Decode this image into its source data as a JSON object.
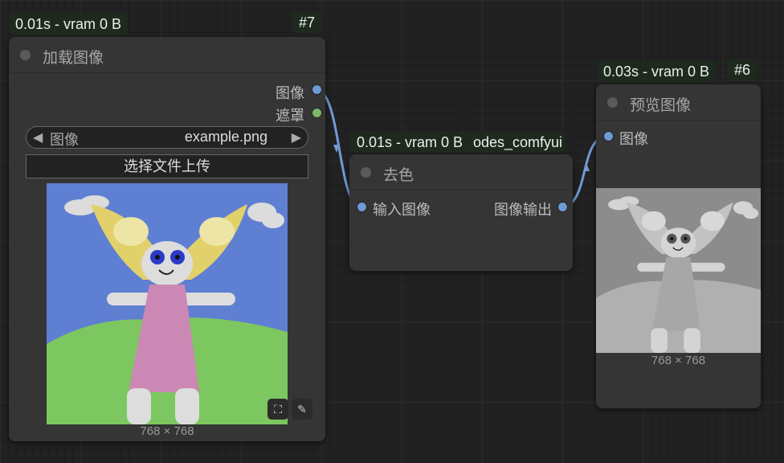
{
  "nodes": {
    "load_image": {
      "timing": "0.01s - vram 0 B",
      "id": "#7",
      "title": "加载图像",
      "outputs": [
        "图像",
        "遮罩"
      ],
      "widget_label": "图像",
      "widget_value": "example.png",
      "upload_label": "选择文件上传",
      "dimensions": "768 × 768"
    },
    "desaturate": {
      "timing": "0.01s - vram 0 B",
      "module": "odes_comfyui",
      "title": "去色",
      "input": "输入图像",
      "output": "图像输出"
    },
    "preview": {
      "timing": "0.03s - vram 0 B",
      "id": "#6",
      "title": "预览图像",
      "input": "图像",
      "dimensions": "768 × 768"
    }
  },
  "colors": {
    "image_port": "#6f9ad6",
    "mask_port": "#7fb56a",
    "link": "#6f9ad6"
  }
}
